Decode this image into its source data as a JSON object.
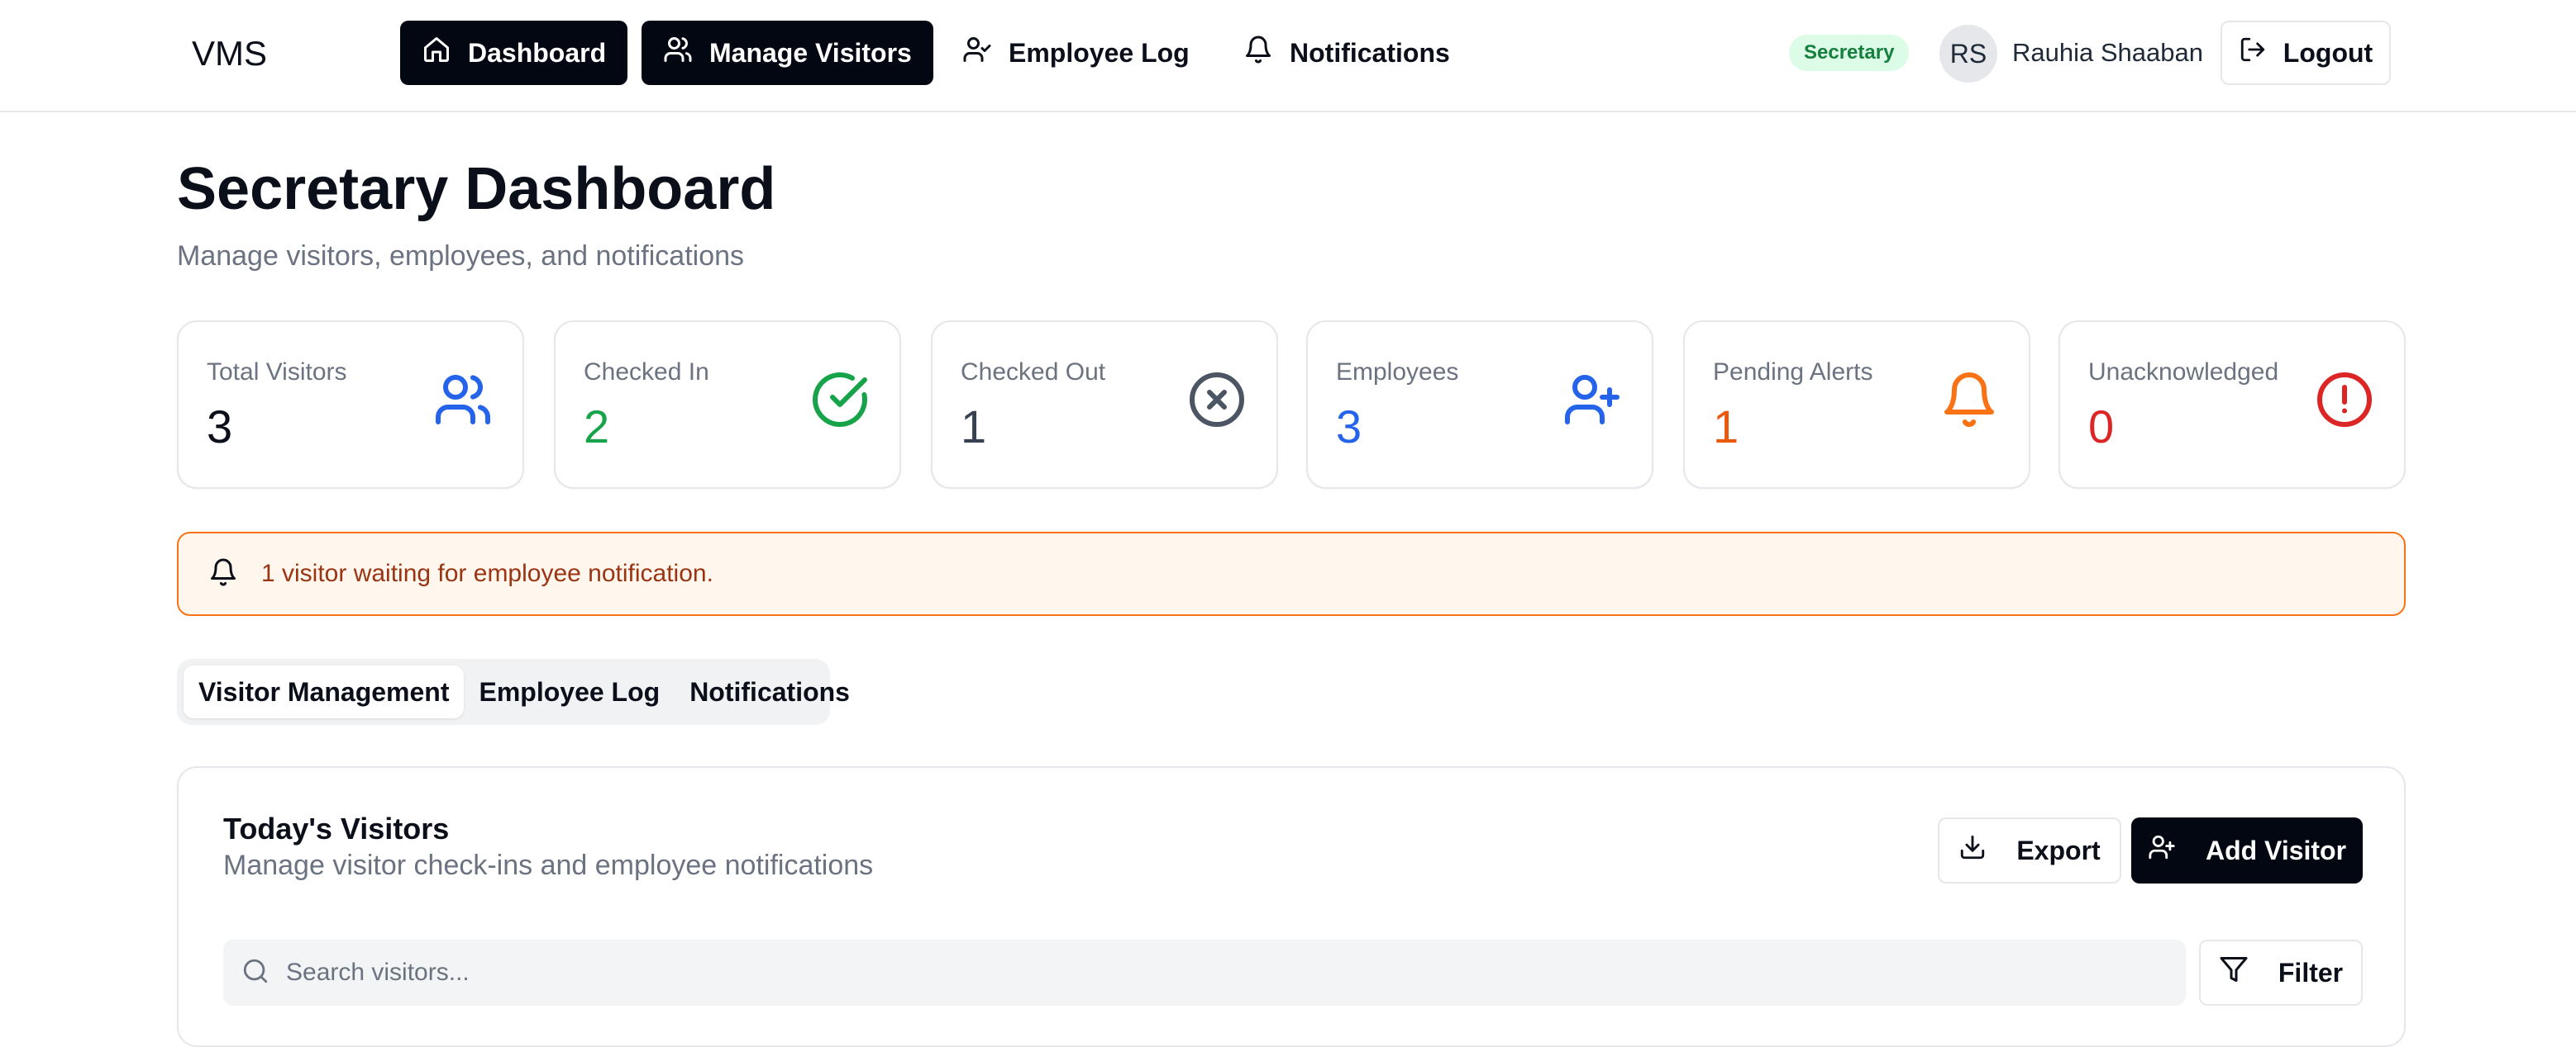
{
  "app": {
    "brand": "VMS"
  },
  "nav": {
    "items": [
      {
        "label": "Dashboard",
        "icon": "home-icon",
        "active": true
      },
      {
        "label": "Manage Visitors",
        "icon": "users-icon",
        "active": true
      },
      {
        "label": "Employee Log",
        "icon": "user-check-icon",
        "active": false
      },
      {
        "label": "Notifications",
        "icon": "bell-icon",
        "active": false
      }
    ],
    "role": "Secretary",
    "user": {
      "initials": "RS",
      "name": "Rauhia Shaaban"
    },
    "logout_label": "Logout"
  },
  "header": {
    "title": "Secretary Dashboard",
    "subtitle": "Manage visitors, employees, and notifications"
  },
  "stats": [
    {
      "label": "Total Visitors",
      "value": "3",
      "icon": "users-icon",
      "color": "#2563eb",
      "value_color": "#0b0f19"
    },
    {
      "label": "Checked In",
      "value": "2",
      "icon": "check-circle-icon",
      "color": "#16a34a",
      "value_color": "#16a34a"
    },
    {
      "label": "Checked Out",
      "value": "1",
      "icon": "x-circle-icon",
      "color": "#4b5563",
      "value_color": "#374151"
    },
    {
      "label": "Employees",
      "value": "3",
      "icon": "user-plus-icon",
      "color": "#2563eb",
      "value_color": "#2563eb"
    },
    {
      "label": "Pending Alerts",
      "value": "1",
      "icon": "bell-icon",
      "color": "#f97316",
      "value_color": "#ea580c"
    },
    {
      "label": "Unacknowledged",
      "value": "0",
      "icon": "alert-circle-icon",
      "color": "#dc2626",
      "value_color": "#dc2626"
    }
  ],
  "alert": {
    "text": "1 visitor waiting for employee notification.",
    "icon": "bell-icon"
  },
  "tabs": [
    {
      "label": "Visitor Management",
      "active": true
    },
    {
      "label": "Employee Log",
      "active": false
    },
    {
      "label": "Notifications",
      "active": false
    }
  ],
  "visitors_panel": {
    "title": "Today's Visitors",
    "subtitle": "Manage visitor check-ins and employee notifications",
    "export_label": "Export",
    "add_label": "Add Visitor",
    "search_placeholder": "Search visitors...",
    "search_value": "",
    "filter_label": "Filter"
  }
}
